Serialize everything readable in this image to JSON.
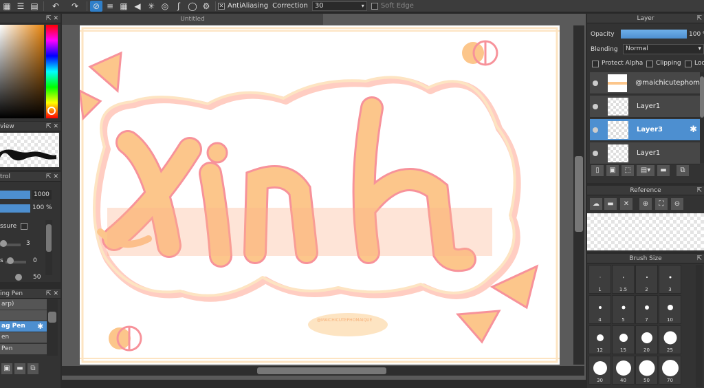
{
  "toolbar": {
    "antialiasing_label": "AntiAliasing",
    "antialiasing_checked": true,
    "correction_label": "Correction",
    "correction_value": "30",
    "soft_edge_label": "Soft Edge",
    "soft_edge_checked": false
  },
  "document": {
    "tab_title": "Untitled"
  },
  "left": {
    "preview_title": "view",
    "control_title": "trol",
    "control_brush_size": "1000",
    "control_opacity": "100 %",
    "pressure_label": "ssure",
    "slider1_value": "3",
    "slider2_label": "s",
    "slider2_value": "0",
    "slider3_value": "50",
    "brush_title": "ing Pen",
    "brush_items": [
      "arp)",
      "",
      "ag Pen",
      "en",
      "Pen"
    ]
  },
  "layer_panel": {
    "title": "Layer",
    "opacity_label": "Opacity",
    "opacity_value": "100 %",
    "opacity_fraction": 1.0,
    "blending_label": "Blending",
    "blending_value": "Normal",
    "protect_alpha_label": "Protect Alpha",
    "clipping_label": "Clipping",
    "lock_label": "Loc",
    "layers": [
      {
        "name": "@maichicutephom",
        "selected": false
      },
      {
        "name": "Layer1",
        "selected": false
      },
      {
        "name": "Layer3",
        "selected": true
      },
      {
        "name": "Layer1",
        "selected": false
      }
    ]
  },
  "reference_panel": {
    "title": "Reference"
  },
  "brush_size_panel": {
    "title": "Brush Size",
    "sizes": [
      "1",
      "1.5",
      "2",
      "3",
      "4",
      "5",
      "7",
      "10",
      "12",
      "15",
      "20",
      "25",
      "30",
      "40",
      "50",
      "70"
    ]
  },
  "artwork": {
    "signature_text": "@MAICHICUTEPHOMAIQUE",
    "colors": {
      "peach": "#fcc68b",
      "pink": "#f7929a",
      "cream": "#fde4c2",
      "outline": "#ffcdc2"
    }
  }
}
